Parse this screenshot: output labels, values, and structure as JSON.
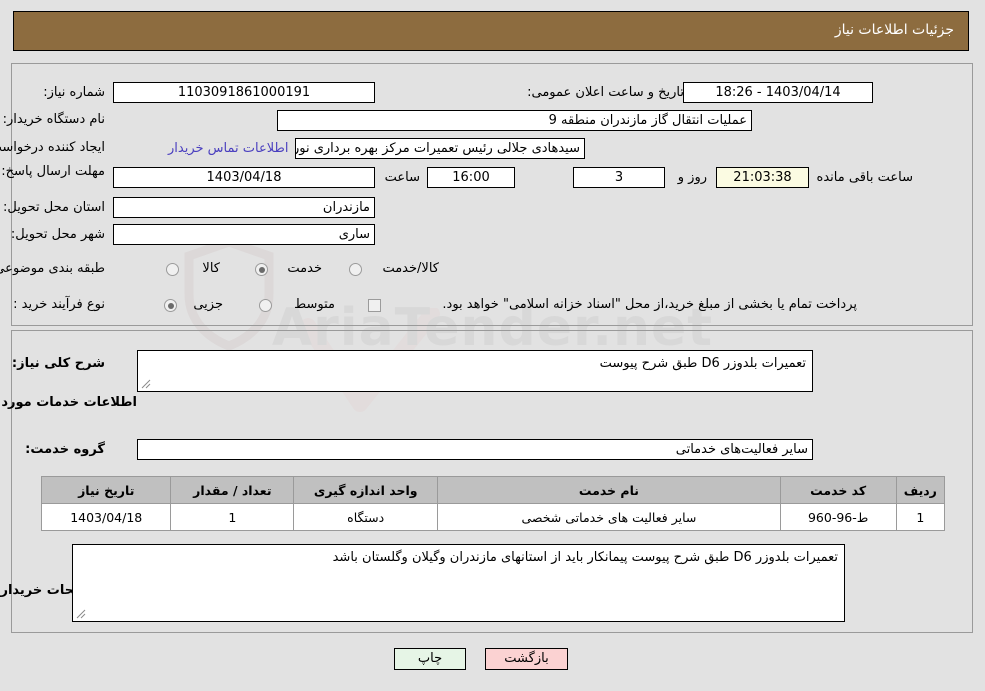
{
  "header": {
    "title": "جزئیات اطلاعات نیاز"
  },
  "top": {
    "need_number_label": "شماره نیاز:",
    "need_number_value": "1103091861000191",
    "announce_label": "تاریخ و ساعت اعلان عمومی:",
    "announce_value": "1403/04/14 - 18:26",
    "buyer_org_label": "نام دستگاه خریدار:",
    "buyer_org_value": "عملیات انتقال گاز مازندران منطقه 9",
    "creator_label": "ایجاد کننده درخواست:",
    "creator_value": "سیدهادی جلالی رئیس تعمیرات مرکز بهره برداری نور عملیات انتقال گاز مازندران",
    "contact_link": "اطلاعات تماس خریدار",
    "deadline_label": "مهلت ارسال پاسخ: تا تاریخ:",
    "deadline_date": "1403/04/18",
    "hour_label": "ساعت",
    "deadline_time": "16:00",
    "days_value": "3",
    "days_label": "روز و",
    "countdown_value": "21:03:38",
    "remaining_label": "ساعت باقی مانده",
    "province_label": "استان محل تحویل:",
    "province_value": "مازندران",
    "city_label": "شهر محل تحویل:",
    "city_value": "ساری",
    "category_label": "طبقه بندی موضوعی:",
    "category_options": [
      {
        "label": "کالا",
        "selected": false
      },
      {
        "label": "خدمت",
        "selected": true
      },
      {
        "label": "کالا/خدمت",
        "selected": false
      }
    ],
    "process_label": "نوع فرآیند خرید :",
    "process_options": [
      {
        "label": "جزیی",
        "selected": true
      },
      {
        "label": "متوسط",
        "selected": false
      }
    ],
    "treasury_checkbox_label": "پرداخت تمام یا بخشی از مبلغ خرید،از محل \"اسناد خزانه اسلامی\" خواهد بود.",
    "treasury_checked": false
  },
  "mid": {
    "general_desc_label": "شرح کلی نیاز:",
    "general_desc_value": "تعمیرات بلدوزر D6 طبق شرح پیوست",
    "services_section_title": "اطلاعات خدمات مورد نیاز",
    "service_group_label": "گروه خدمت:",
    "service_group_value": "سایر فعالیت‌های خدماتی",
    "table": {
      "headers": [
        "ردیف",
        "کد خدمت",
        "نام خدمت",
        "واحد اندازه گیری",
        "تعداد / مقدار",
        "تاریخ نیاز"
      ],
      "rows": [
        {
          "row": "1",
          "code": "ط-96-960",
          "name": "سایر فعالیت های خدماتی شخصی",
          "unit": "دستگاه",
          "quantity": "1",
          "need_date": "1403/04/18"
        }
      ]
    },
    "buyer_notes_label": "توضیحات خریدار:",
    "buyer_notes_value": "تعمیرات بلدوزر D6 طبق شرح پیوست پیمانکار باید از استانهای مازندران وگیلان وگلستان باشد"
  },
  "footer": {
    "print_label": "چاپ",
    "back_label": "بازگشت"
  },
  "watermark": {
    "text": "AriaTender.net"
  },
  "colors": {
    "header_bg": "#8d6c3f",
    "page_bg": "#e2e2e2",
    "link": "#4a3fbf",
    "table_header_bg": "#c0c0c0",
    "print_btn_bg": "#e6f5e6",
    "back_btn_bg": "#fbd2d2",
    "countdown_bg": "#fbfbe2"
  }
}
